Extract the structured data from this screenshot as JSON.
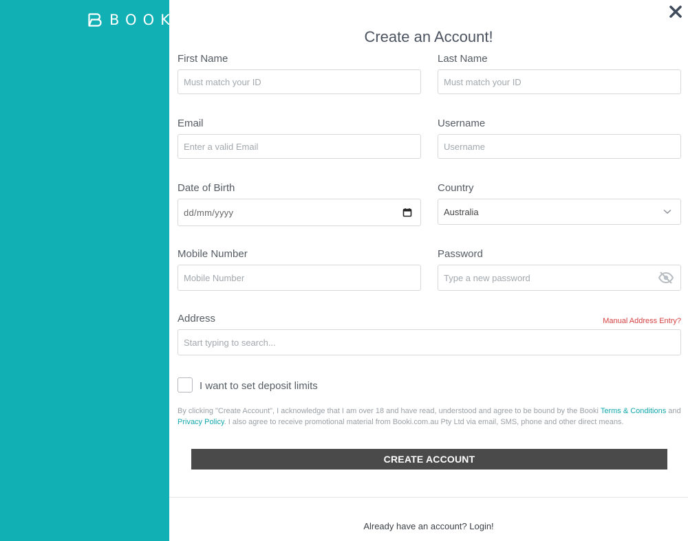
{
  "brand": {
    "name": "BOOKI",
    "color": "#10b0b5"
  },
  "title": "Create an Account!",
  "fields": {
    "first_name": {
      "label": "First Name",
      "placeholder": "Must match your ID"
    },
    "last_name": {
      "label": "Last Name",
      "placeholder": "Must match your ID"
    },
    "email": {
      "label": "Email",
      "placeholder": "Enter a valid Email"
    },
    "username": {
      "label": "Username",
      "placeholder": "Username"
    },
    "dob": {
      "label": "Date of Birth",
      "placeholder": "dd/mm/yyyy"
    },
    "country": {
      "label": "Country",
      "value": "Australia"
    },
    "mobile": {
      "label": "Mobile Number",
      "placeholder": "Mobile Number"
    },
    "password": {
      "label": "Password",
      "placeholder": "Type a new password"
    },
    "address": {
      "label": "Address",
      "placeholder": "Start typing to search..."
    }
  },
  "manual_address_link": "Manual Address Entry?",
  "deposit_limits_label": "I want to set deposit limits",
  "terms": {
    "prefix": "By clicking \"Create Account\", I acknowledge that I am over 18 and have read, understood and agree to be bound by the Booki ",
    "terms_link": "Terms & Conditions",
    "and": " and ",
    "privacy_link": "Privacy Policy",
    "suffix": ". I also agree to receive promotional material from Booki.com.au Pty Ltd via email, SMS, phone and other direct means."
  },
  "create_button": "CREATE ACCOUNT",
  "login_text": "Already have an account? Login!",
  "icons": {
    "close": "close-icon",
    "calendar": "calendar-icon",
    "chevron": "chevron-down-icon",
    "eye": "eye-slash-icon",
    "logo": "booki-logo-icon"
  }
}
